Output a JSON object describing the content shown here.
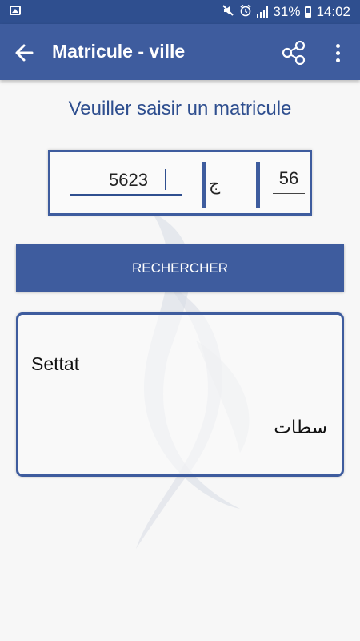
{
  "status_bar": {
    "battery": "31%",
    "time": "14:02"
  },
  "app_bar": {
    "title": "Matricule - ville"
  },
  "form": {
    "heading": "Veuiller saisir un matricule",
    "plate_number": "5623",
    "plate_letter": "ج",
    "plate_region": "56",
    "search_label": "RECHERCHER"
  },
  "result": {
    "city_fr": "Settat",
    "city_ar": "سطات"
  },
  "colors": {
    "primary": "#3e5c9e",
    "status_bar": "#2f4f8f",
    "heading": "#2f4f8f"
  },
  "icons": {
    "status_left": "gallery-icon",
    "status_right": [
      "mute-icon",
      "alarm-icon",
      "signal-icon",
      "battery-icon"
    ],
    "app_bar": [
      "back-arrow-icon",
      "share-icon",
      "more-vert-icon"
    ]
  }
}
